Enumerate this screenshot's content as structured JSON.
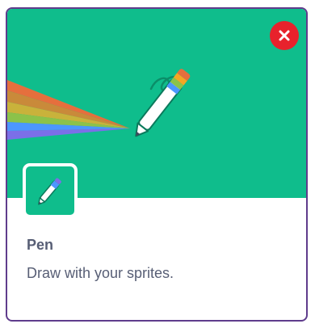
{
  "extension": {
    "name": "Pen",
    "description": "Draw with your sprites.",
    "icon": "pen-icon",
    "colors": {
      "banner": "#0fbd8c",
      "border": "#5f3c8c",
      "close": "#e8222c",
      "text": "#575e75"
    }
  },
  "close_button": {
    "icon": "close-icon"
  }
}
